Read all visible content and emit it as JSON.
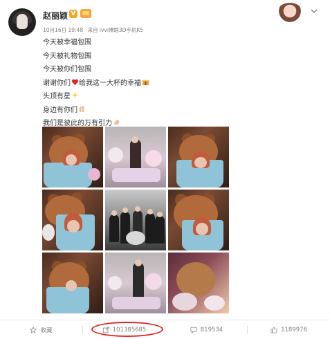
{
  "post": {
    "author": "赵丽颖",
    "verified_badge": "V",
    "timestamp": "10月16日 19:48",
    "source": "来自 ivvi裸眼3D手机K5",
    "lines": [
      "今天被幸福包围",
      "今天被礼物包围",
      "今天被你们包围",
      "谢谢你们",
      "给我这一大杯的幸福",
      "头顶有星",
      "身边有你们",
      "我们是彼此的万有引力"
    ]
  },
  "images": [
    {
      "kind": "teddy-cup"
    },
    {
      "kind": "stage-crowd"
    },
    {
      "kind": "teddy-cup"
    },
    {
      "kind": "teddy-cup"
    },
    {
      "kind": "group-photo"
    },
    {
      "kind": "teddy-cup"
    },
    {
      "kind": "teddy-cup"
    },
    {
      "kind": "stage-crowd"
    },
    {
      "kind": "stage-lights"
    }
  ],
  "actions": {
    "favorite": {
      "label": "收藏",
      "icon": "star-icon"
    },
    "repost": {
      "count": "101385685",
      "icon": "repost-icon"
    },
    "comment": {
      "count": "819534",
      "icon": "comment-icon"
    },
    "like": {
      "count": "1189976",
      "icon": "thumbs-up-icon"
    }
  },
  "colors": {
    "accent_orange": "#f5a623",
    "highlight_red": "#e32020",
    "text_gray": "#808080"
  }
}
